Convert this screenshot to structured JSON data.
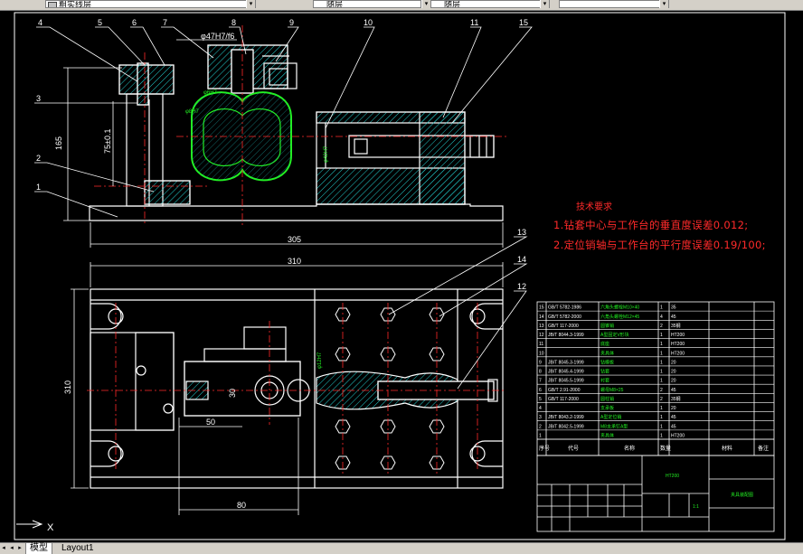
{
  "toolbar": {
    "layer_name": "粗实线层",
    "style_1": "随层",
    "style_2": "随层"
  },
  "tabs": [
    {
      "label": "模型",
      "active": true
    },
    {
      "label": "Layout1",
      "active": false
    }
  ],
  "ucs": {
    "x_label": "X"
  },
  "callouts": [
    "1",
    "2",
    "3",
    "4",
    "5",
    "6",
    "7",
    "8",
    "9",
    "10",
    "11",
    "12",
    "13",
    "14",
    "15"
  ],
  "dimensions": {
    "height_main": "165",
    "height_upper": "75±0.1",
    "width_front": "305",
    "width_top": "310",
    "height_top": "310",
    "dim_upper": "φ47H7/f6",
    "dim_30": "30",
    "dim_50": "50",
    "dim_80": "80",
    "dim_side": "φ42H7",
    "dim_small_1": "φ6H7",
    "dim_small_2": "φ8H7",
    "dim_small_3": "φ12H7"
  },
  "technical_requirements": {
    "title": "技术要求",
    "lines": [
      "1.钻套中心与工作台的垂直度误差0.012;",
      "2.定位销轴与工作台的平行度误差0.19/100;"
    ]
  },
  "bom": {
    "rows": [
      {
        "no": "15",
        "std": "GB/T 5782-1986",
        "name": "六角头螺栓M10×40",
        "qty": "1",
        "mat": "35",
        "note": ""
      },
      {
        "no": "14",
        "std": "GB/T 5782-2000",
        "name": "六角头螺栓M12×45",
        "qty": "4",
        "mat": "45",
        "note": ""
      },
      {
        "no": "13",
        "std": "GB/T 117-2000",
        "name": "圆锥销",
        "qty": "2",
        "mat": "35钢",
        "note": ""
      },
      {
        "no": "12",
        "std": "JB/T 8044.3-1999",
        "name": "A型固定V形块",
        "qty": "1",
        "mat": "HT200",
        "note": ""
      },
      {
        "no": "11",
        "std": "",
        "name": "底座",
        "qty": "1",
        "mat": "HT200",
        "note": ""
      },
      {
        "no": "10",
        "std": "",
        "name": "夹具体",
        "qty": "1",
        "mat": "HT200",
        "note": ""
      },
      {
        "no": "9",
        "std": "JB/T 8045.3-1999",
        "name": "钻模板",
        "qty": "1",
        "mat": "20",
        "note": ""
      },
      {
        "no": "8",
        "std": "JB/T 8045.4-1999",
        "name": "钻套",
        "qty": "1",
        "mat": "20",
        "note": ""
      },
      {
        "no": "7",
        "std": "JB/T 8045.5-1999",
        "name": "衬套",
        "qty": "1",
        "mat": "20",
        "note": ""
      },
      {
        "no": "6",
        "std": "GB/T 2.91-2000",
        "name": "螺母M8×25",
        "qty": "2",
        "mat": "45",
        "note": ""
      },
      {
        "no": "5",
        "std": "GB/T 117-2000",
        "name": "圆柱销",
        "qty": "2",
        "mat": "35钢",
        "note": ""
      },
      {
        "no": "4",
        "std": "",
        "name": "支承板",
        "qty": "1",
        "mat": "20",
        "note": ""
      },
      {
        "no": "3",
        "std": "JB/T 8043.2-1999",
        "name": "A型定位销",
        "qty": "1",
        "mat": "45",
        "note": ""
      },
      {
        "no": "2",
        "std": "JB/T 8042.5-1999",
        "name": "M8支承钉A型",
        "qty": "1",
        "mat": "45",
        "note": ""
      },
      {
        "no": "1",
        "std": "",
        "name": "夹具体",
        "qty": "1",
        "mat": "HT200",
        "note": ""
      }
    ],
    "header": {
      "no": "序号",
      "std": "代号",
      "name": "名称",
      "qty": "数量",
      "mat": "材料",
      "note": "备注"
    },
    "material": "HT200",
    "drawing_name": "夹具装配图",
    "scale": "1:1"
  }
}
